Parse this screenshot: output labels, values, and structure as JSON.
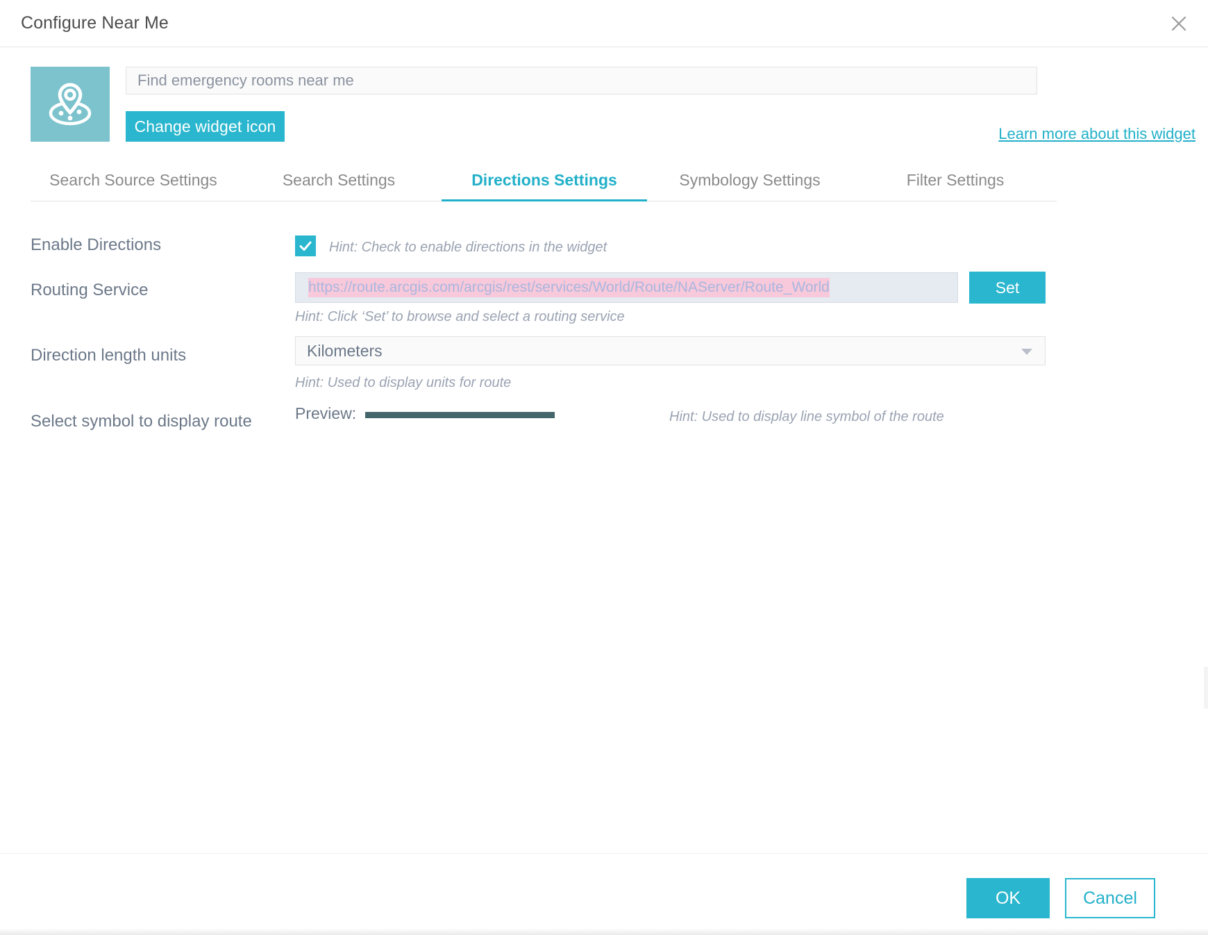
{
  "window": {
    "title": "Configure Near Me",
    "close_icon": "close-icon"
  },
  "header": {
    "widget_icon_name": "near-me-map-pin-icon",
    "widget_icon_bg": "#7cc3cd",
    "name_field": {
      "value": "",
      "placeholder": "Find emergency rooms near me"
    },
    "change_icon_button": "Change widget icon",
    "learn_more_link": "Learn more about this widget"
  },
  "tabs": [
    {
      "label": "Search Source Settings",
      "active": false
    },
    {
      "label": "Search Settings",
      "active": false
    },
    {
      "label": "Directions Settings",
      "active": true
    },
    {
      "label": "Symbology Settings",
      "active": false
    },
    {
      "label": "Filter Settings",
      "active": false
    }
  ],
  "form": {
    "enable_directions": {
      "label": "Enable Directions",
      "checked": true,
      "hint": "Hint: Check to enable directions in the widget"
    },
    "routing_service": {
      "label": "Routing Service",
      "url": "https://route.arcgis.com/arcgis/rest/services/World/Route/NAServer/Route_World",
      "set_button": "Set",
      "hint": "Hint: Click ‘Set’ to browse and select a routing service"
    },
    "direction_length_units": {
      "label": "Direction length units",
      "selected": "Kilometers",
      "hint": "Hint: Used to display units for route"
    },
    "route_symbol": {
      "label": "Select symbol to display route",
      "preview_label": "Preview:",
      "preview_color": "#43656b",
      "hint": "Hint: Used to display line symbol of the route"
    }
  },
  "footer": {
    "ok_label": "OK",
    "cancel_label": "Cancel"
  },
  "colors": {
    "accent": "#29b6ce",
    "accent_text": "#21b0c9",
    "label_text": "#6c7889",
    "hint_text": "#9aa3b2",
    "highlight": "#f7c9da"
  }
}
